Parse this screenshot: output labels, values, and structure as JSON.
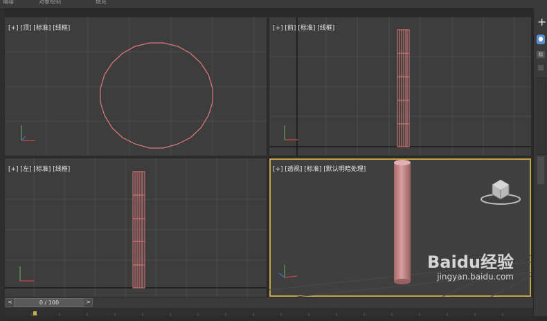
{
  "menubar": {
    "items": [
      "编辑",
      "对象绘制",
      "填充"
    ]
  },
  "viewports": {
    "top": {
      "label": "[+] [顶] [标准] [线框]"
    },
    "front": {
      "label": "[+] [前] [标准] [线框]"
    },
    "left": {
      "label": "[+] [左] [标准] [线框]"
    },
    "persp": {
      "label": "[+] [透视] [标准] [默认明暗处理]"
    }
  },
  "timeline": {
    "frame": "0 / 100",
    "prev": "<",
    "next": ">"
  },
  "side_panel": {
    "add_glyph": "+",
    "tab_label": "标"
  },
  "watermark": {
    "brand": "Baidu经验",
    "url": "jingyan.baidu.com"
  },
  "colors": {
    "viewport_bg": "#3d3d3d",
    "grid": "#545454",
    "object_wire": "#e07a7a",
    "active_border": "#c8a24a",
    "cylinder": "#c98b8b"
  }
}
